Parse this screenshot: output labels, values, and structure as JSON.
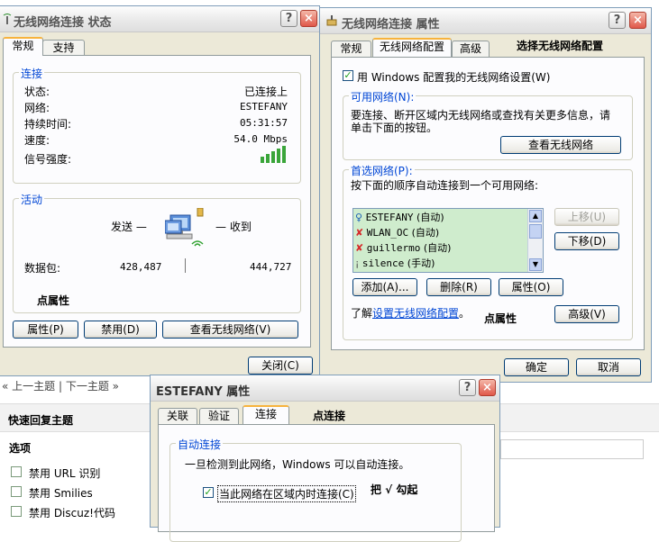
{
  "status_dialog": {
    "title": "无线网络连接   状态",
    "help": "?",
    "close": "×",
    "tabs": [
      "常规",
      "支持"
    ],
    "connection_group": "连接",
    "rows": [
      {
        "label": "状态:",
        "value": "已连接上"
      },
      {
        "label": "网络:",
        "value": "ESTEFANY"
      },
      {
        "label": "持续时间:",
        "value": "05:31:57"
      },
      {
        "label": "速度:",
        "value": "54.0 Mbps"
      },
      {
        "label": "信号强度:",
        "value": ""
      }
    ],
    "activity_group": "活动",
    "sent_label": "发送 —",
    "received_label": "— 收到",
    "packets_label": "数据包:",
    "sent_packets": "428,487",
    "received_packets": "444,727",
    "annotation": "点属性",
    "buttons": {
      "properties": "属性(P)",
      "disable": "禁用(D)",
      "view_wireless": "查看无线网络(V)"
    },
    "close_button": "关闭(C)"
  },
  "props_dialog": {
    "title": "无线网络连接   属性",
    "help": "?",
    "close": "×",
    "tabs": [
      "常规",
      "无线网络配置",
      "高级"
    ],
    "annotation_top": "选择无线网络配置",
    "use_windows_checkbox": "用 Windows 配置我的无线网络设置(W)",
    "available_group": "可用网络(N):",
    "available_text_1": "要连接、断开区域内无线网络或查找有关更多信息，请",
    "available_text_2": "单击下面的按钮。",
    "view_wireless_button": "查看无线网络",
    "preferred_group": "首选网络(P):",
    "preferred_text": "按下面的顺序自动连接到一个可用网络:",
    "networks": [
      {
        "name": "ESTEFANY",
        "mode": "(自动)"
      },
      {
        "name": "WLAN_OC",
        "mode": "(自动)"
      },
      {
        "name": "guillermo",
        "mode": "(自动)"
      },
      {
        "name": "silence",
        "mode": "(手动)"
      }
    ],
    "move_up": "上移(U)",
    "move_down": "下移(D)",
    "add": "添加(A)...",
    "remove": "删除(R)",
    "properties": "属性(O)",
    "learn_prefix": "了解",
    "learn_link": "设置无线网络配置",
    "learn_suffix": "。",
    "annotation_bottom": "点属性",
    "advanced": "高级(V)",
    "ok": "确定",
    "cancel": "取消"
  },
  "estefany_dialog": {
    "title": "ESTEFANY 属性",
    "help": "?",
    "close": "×",
    "tabs": [
      "关联",
      "验证",
      "连接"
    ],
    "annotation_tab": "点连接",
    "auto_group": "自动连接",
    "auto_text": "一旦检测到此网络，Windows 可以自动连接。",
    "auto_checkbox": "当此网络在区域内时连接(C)",
    "annotation_check": "把 √ 勾起"
  },
  "background_page": {
    "nav_text": "« 上一主题 | 下一主题 »",
    "quick_reply": "快速回复主题",
    "options_heading": "选项",
    "options": [
      "禁用 URL 识别",
      "禁用 Smilies",
      "禁用 Discuz!代码"
    ]
  },
  "colors": {
    "accent": "#0046d5",
    "list_bg": "#cfeccd",
    "tab_highlight": "#f7b33d"
  }
}
